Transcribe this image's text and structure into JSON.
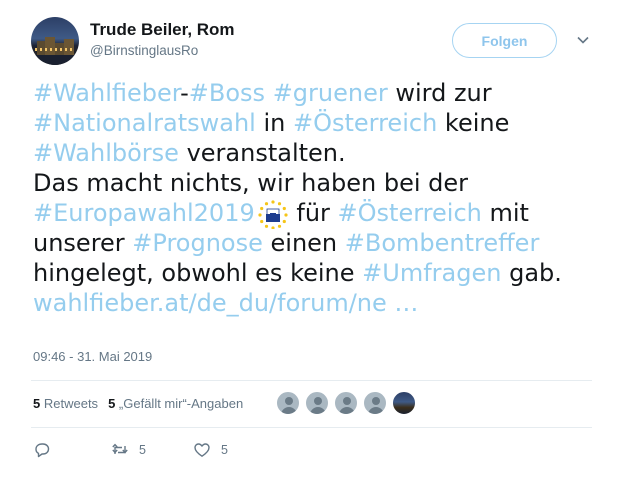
{
  "author": {
    "name": "Trude Beiler, Rom",
    "handle": "@BirnstinglausRo",
    "avatar_icon": "avatar-photo-icon"
  },
  "follow_button": {
    "label": "Folgen"
  },
  "tweet_text": {
    "l1_t1": "#Wahlfieber",
    "l1_t2": "-",
    "l1_t3": "#Boss",
    "l1_t4": " ",
    "l1_t5": "#gruener",
    "l1_t6": " wird zur",
    "l2_t1": "#Nationalratswahl",
    "l2_t2": " in ",
    "l2_t3": "#Österreich",
    "l2_t4": " keine",
    "l3_t1": "#Wahlbörse",
    "l3_t2": " veranstalten.",
    "l4_t1": "Das macht nichts, wir haben bei der",
    "l5_t1": "#Europawahl2019",
    "l5_t2": " für ",
    "l5_t3": "#Österreich",
    "l5_t4": " mit",
    "l6_t1": "unserer ",
    "l6_t2": "#Prognose",
    "l6_t3": " einen ",
    "l6_t4": "#Bombentreffer",
    "l7_t1": "hingelegt, obwohl es keine ",
    "l7_t2": "#Umfragen",
    "l7_t3": " gab.",
    "l8_link": "wahlfieber.at/de_du/forum/ne …"
  },
  "timestamp": "09:46 - 31. Mai 2019",
  "stats": {
    "retweets_count": "5",
    "retweets_label": "Retweets",
    "likes_count": "5",
    "likes_label": "„Gefällt mir“-Angaben"
  },
  "actions": {
    "reply_icon": "reply-icon",
    "retweet_icon": "retweet-icon",
    "retweet_count": "5",
    "like_icon": "heart-icon",
    "like_count": "5"
  },
  "colors": {
    "hashtag": "#95cdee",
    "follow_border": "#a6d4f2",
    "muted": "#657786",
    "text": "#14171a",
    "divider": "#e6ecf0"
  }
}
